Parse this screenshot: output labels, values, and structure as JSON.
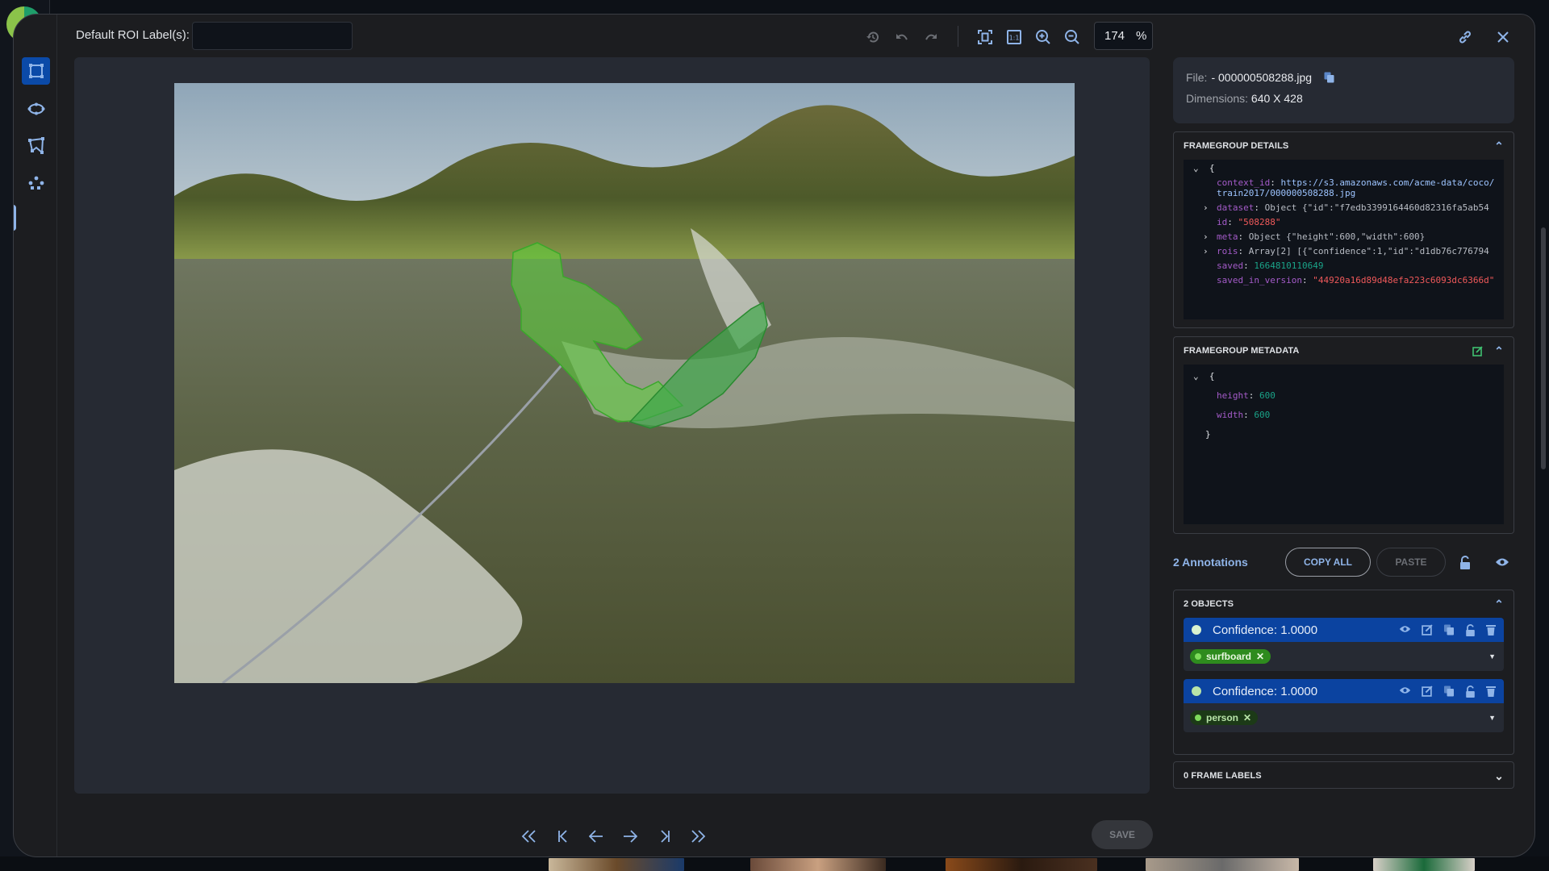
{
  "header": {
    "roi_label": "Default ROI Label(s):",
    "roi_input_value": "",
    "zoom_value": "174",
    "zoom_unit": "%"
  },
  "file": {
    "file_label": "File:",
    "file_name": "- 000000508288.jpg",
    "dimensions_label": "Dimensions:",
    "dimensions_value": "640 X 428"
  },
  "framegroup_details": {
    "title": "FRAMEGROUP DETAILS",
    "open_brace": "{",
    "rows": [
      {
        "key": "context_id",
        "value": "https://s3.amazonaws.com/acme-data/coco/train2017/000000508288.jpg",
        "type": "url"
      },
      {
        "key": "dataset",
        "value": "Object {\"id\":\"f7edb3399164460d82316fa5ab54",
        "type": "obj",
        "expandable": true
      },
      {
        "key": "id",
        "value": "\"508288\"",
        "type": "str"
      },
      {
        "key": "meta",
        "value": "Object {\"height\":600,\"width\":600}",
        "type": "obj",
        "expandable": true
      },
      {
        "key": "rois",
        "value": "Array[2] [{\"confidence\":1,\"id\":\"d1db76c776794",
        "type": "obj",
        "expandable": true
      },
      {
        "key": "saved",
        "value": "1664810110649",
        "type": "num"
      },
      {
        "key": "saved_in_version",
        "value": "\"44920a16d89d48efa223c6093dc6366d\"",
        "type": "str"
      }
    ]
  },
  "framegroup_metadata": {
    "title": "FRAMEGROUP METADATA",
    "open_brace": "{",
    "close_brace": "}",
    "rows": [
      {
        "key": "height",
        "value": "600"
      },
      {
        "key": "width",
        "value": "600"
      }
    ]
  },
  "annotations": {
    "count_label": "2 Annotations",
    "copy_all": "COPY ALL",
    "paste": "PASTE"
  },
  "objects": {
    "title": "2 OBJECTS",
    "items": [
      {
        "confidence": "Confidence: 1.0000",
        "label": "surfboard",
        "color": "#2e8b1e"
      },
      {
        "confidence": "Confidence: 1.0000",
        "label": "person",
        "color": "#1c3a17"
      }
    ]
  },
  "frame_labels": {
    "title": "0 FRAME LABELS"
  },
  "footer": {
    "save": "SAVE"
  },
  "colors": {
    "accent": "#0b43a0",
    "link": "#9dc4ff",
    "annotation_fill": "#5bd33a"
  }
}
